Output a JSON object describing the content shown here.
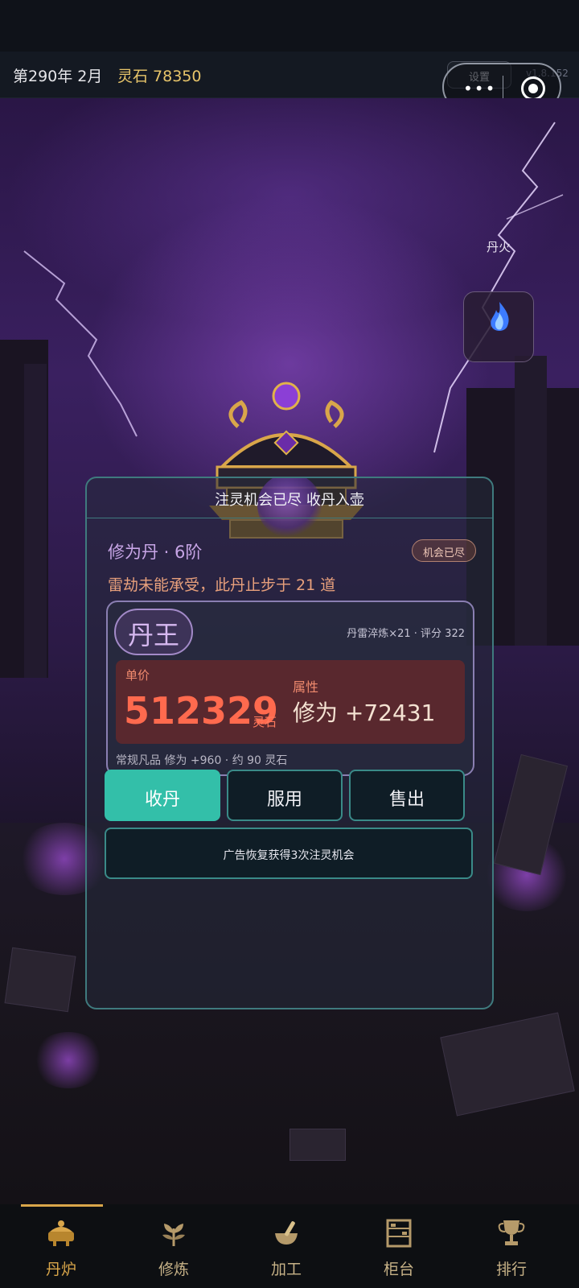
{
  "header": {
    "date": "第290年 2月",
    "spirit_stone": "灵石 78350",
    "settings_label": "设置",
    "version": "v1.8.152"
  },
  "side": {
    "dan_fire_label": "丹火"
  },
  "panel": {
    "header_title": "注灵机会已尽 收丹入壶",
    "pill_name": "修为丹 · 6阶",
    "chance_badge": "机会已尽",
    "status": "雷劫未能承受，此丹止步于 21 道",
    "grade": "丹王",
    "refine_info": "丹雷淬炼×21 · 评分 322",
    "price_label": "单价",
    "price_value": "512329",
    "price_unit": "灵石",
    "attr_label": "属性",
    "attr_value": "修为 +72431",
    "normal_info": "常规凡品 修为 +960 · 约 90 灵石"
  },
  "actions": {
    "collect": "收丹",
    "take": "服用",
    "sell": "售出",
    "ad_restore": "广告恢复获得3次注灵机会"
  },
  "tabs": [
    {
      "label": "丹炉",
      "icon": "cauldron-icon",
      "active": true
    },
    {
      "label": "修炼",
      "icon": "herb-icon",
      "active": false
    },
    {
      "label": "加工",
      "icon": "mortar-icon",
      "active": false
    },
    {
      "label": "柜台",
      "icon": "cabinet-icon",
      "active": false
    },
    {
      "label": "排行",
      "icon": "trophy-icon",
      "active": false
    }
  ],
  "colors": {
    "accent_teal": "#33bfa9",
    "gold": "#d9a64a",
    "price_red": "#ff6a4e"
  }
}
